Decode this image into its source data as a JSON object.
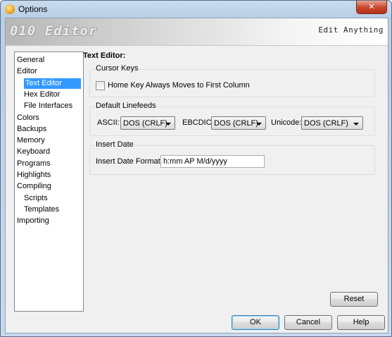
{
  "window": {
    "title": "Options",
    "close_glyph": "✕"
  },
  "banner": {
    "logo": "010 Editor",
    "tagline": "Edit Anything"
  },
  "nav": {
    "items": [
      {
        "label": "General",
        "indent": 0
      },
      {
        "label": "Editor",
        "indent": 0
      },
      {
        "label": "Text Editor",
        "indent": 1,
        "selected": true
      },
      {
        "label": "Hex Editor",
        "indent": 1
      },
      {
        "label": "File Interfaces",
        "indent": 1
      },
      {
        "label": "Colors",
        "indent": 0
      },
      {
        "label": "Backups",
        "indent": 0
      },
      {
        "label": "Memory",
        "indent": 0
      },
      {
        "label": "Keyboard",
        "indent": 0
      },
      {
        "label": "Programs",
        "indent": 0
      },
      {
        "label": "Highlights",
        "indent": 0
      },
      {
        "label": "Compiling",
        "indent": 0
      },
      {
        "label": "Scripts",
        "indent": 1
      },
      {
        "label": "Templates",
        "indent": 1
      },
      {
        "label": "Importing",
        "indent": 0
      }
    ]
  },
  "content": {
    "title": "Text Editor:",
    "cursor_keys": {
      "label": "Cursor Keys",
      "home_key_label": "Home Key Always Moves to First Column",
      "home_key_checked": false
    },
    "linefeeds": {
      "label": "Default Linefeeds",
      "ascii_label": "ASCII:",
      "ascii_value": "DOS (CRLF)",
      "ebcdic_label": "EBCDIC:",
      "ebcdic_value": "DOS (CRLF)",
      "unicode_label": "Unicode:",
      "unicode_value": "DOS (CRLF)"
    },
    "insert_date": {
      "label": "Insert Date",
      "format_label": "Insert Date Format:",
      "format_value": "h:mm AP M/d/yyyy"
    },
    "reset_label": "Reset"
  },
  "footer": {
    "ok_label": "OK",
    "cancel_label": "Cancel",
    "help_label": "Help"
  }
}
